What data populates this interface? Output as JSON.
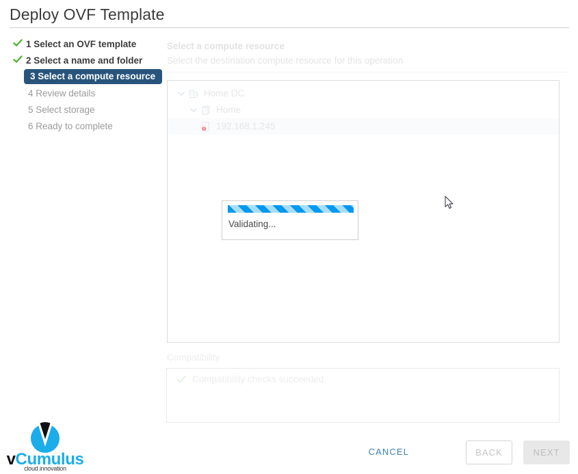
{
  "window": {
    "title": "Deploy OVF Template"
  },
  "steps": [
    {
      "label": "1 Select an OVF template",
      "state": "done",
      "icon": "check-icon"
    },
    {
      "label": "2 Select a name and folder",
      "state": "done",
      "icon": "check-icon"
    },
    {
      "label": "3 Select a compute resource",
      "state": "current",
      "icon": ""
    },
    {
      "label": "4 Review details",
      "state": "todo",
      "icon": ""
    },
    {
      "label": "5 Select storage",
      "state": "todo",
      "icon": ""
    },
    {
      "label": "6 Ready to complete",
      "state": "todo",
      "icon": ""
    }
  ],
  "content": {
    "heading": "Select a compute resource",
    "description": "Select the destination compute resource for this operation"
  },
  "tree": {
    "items": [
      {
        "label": "Home DC",
        "level": 0,
        "icon": "datacenter-icon",
        "twisty": "chevron-down-icon",
        "selected": false,
        "error": false
      },
      {
        "label": "Home",
        "level": 1,
        "icon": "cluster-icon",
        "twisty": "chevron-down-icon",
        "selected": false,
        "error": false
      },
      {
        "label": "192.168.1.245",
        "level": 2,
        "icon": "host-icon",
        "twisty": "",
        "selected": true,
        "error": true
      }
    ]
  },
  "modal": {
    "text": "Validating...",
    "progress_type": "indeterminate-striped",
    "progress_color": "#0099ee",
    "progress_track_color": "#a8ddfa"
  },
  "compatibility": {
    "title": "Compatibility",
    "message": "Compatibility checks succeeded.",
    "icon": "check-icon"
  },
  "footer": {
    "cancel_label": "CANCEL",
    "back_label": "BACK",
    "next_label": "NEXT"
  },
  "logo": {
    "word_v": "v",
    "word_rest": "Cumulus",
    "tagline": "cloud innovation",
    "brand_color": "#1badea"
  },
  "colors": {
    "current_step_badge": "#28547c",
    "check_green": "#4caf2f",
    "link_blue": "#3b7fb4",
    "error_red": "#e8616a"
  }
}
